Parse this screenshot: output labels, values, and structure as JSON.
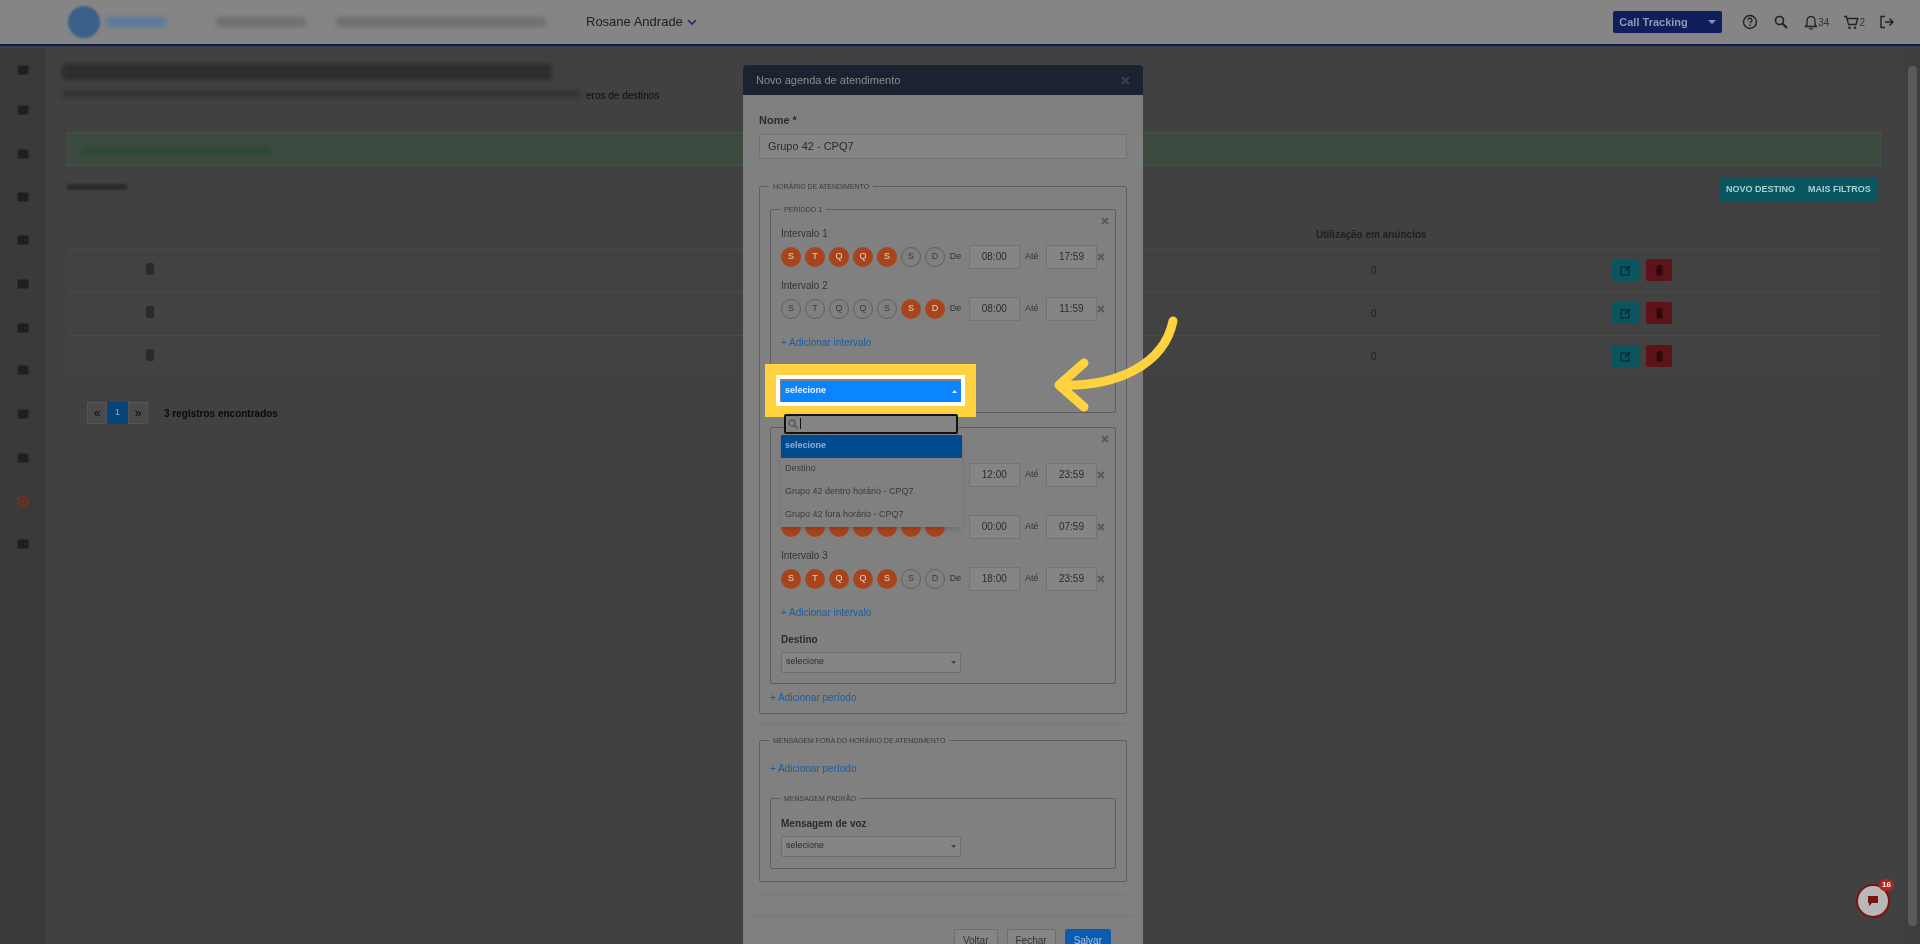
{
  "topbar": {
    "user": "Rosane Andrade",
    "product": "Call Tracking",
    "notifications": "34",
    "cart": "2"
  },
  "page": {
    "subtitle_tail": "eros de destinos",
    "buttons": [
      "NOVO DESTINO",
      "MAIS FILTROS"
    ],
    "column": "Utilização em anúncios",
    "rows": [
      {
        "usage": "0"
      },
      {
        "usage": "0"
      },
      {
        "usage": "0"
      }
    ],
    "pages": [
      {
        "label": "1",
        "selected": true
      }
    ],
    "prev": "«",
    "next": "»",
    "count": "3 registros encontrados"
  },
  "modal": {
    "title": "Novo agenda de atendimento",
    "name_label": "Nome *",
    "name_value": "Grupo 42 - CPQ7",
    "schedule": {
      "legend": "HORÁRIO DE ATENDIMENTO",
      "add_period": "+ Adicionar período",
      "periods": [
        {
          "legend": "PERÍODO 1",
          "add_interval": "+ Adicionar intervalo",
          "destination": {
            "value": "selecione",
            "highlighted": true
          },
          "intervals": [
            {
              "label": "Intervalo 1",
              "days": [
                {
                  "letter": "S",
                  "on": true
                },
                {
                  "letter": "T",
                  "on": true
                },
                {
                  "letter": "Q",
                  "on": true
                },
                {
                  "letter": "Q",
                  "on": true
                },
                {
                  "letter": "S",
                  "on": true
                },
                {
                  "letter": "S",
                  "on": false
                },
                {
                  "letter": "D",
                  "on": false
                }
              ],
              "from_label": "De",
              "from": "08:00",
              "to_label": "Até",
              "to": "17:59"
            },
            {
              "label": "Intervalo 2",
              "days": [
                {
                  "letter": "S",
                  "on": false
                },
                {
                  "letter": "T",
                  "on": false
                },
                {
                  "letter": "Q",
                  "on": false
                },
                {
                  "letter": "Q",
                  "on": false
                },
                {
                  "letter": "S",
                  "on": false
                },
                {
                  "letter": "S",
                  "on": true
                },
                {
                  "letter": "D",
                  "on": true
                }
              ],
              "from_label": "De",
              "from": "08:00",
              "to_label": "Até",
              "to": "11:59"
            }
          ]
        },
        {
          "add_interval": "+ Adicionar intervalo",
          "destination": {
            "label": "Destino",
            "value": "selecione",
            "highlighted": false
          },
          "intervals": [
            {
              "from": "12:00",
              "to_label": "Até",
              "to": "23:59"
            },
            {
              "days": [
                {
                  "on": true
                },
                {
                  "on": true
                },
                {
                  "on": true
                },
                {
                  "on": true
                },
                {
                  "on": true
                },
                {
                  "on": true
                },
                {
                  "on": true
                }
              ],
              "from": "00:00",
              "to_label": "Até",
              "to": "07:59"
            },
            {
              "label": "Intervalo 3",
              "days": [
                {
                  "letter": "S",
                  "on": true
                },
                {
                  "letter": "T",
                  "on": true
                },
                {
                  "letter": "Q",
                  "on": true
                },
                {
                  "letter": "Q",
                  "on": true
                },
                {
                  "letter": "S",
                  "on": true
                },
                {
                  "letter": "S",
                  "on": false
                },
                {
                  "letter": "D",
                  "on": false
                }
              ],
              "from_label": "De",
              "from": "18:00",
              "to_label": "Até",
              "to": "23:59"
            }
          ]
        }
      ]
    },
    "off_hours": {
      "legend": "MENSAGEM FORA DO HORÁRIO DE ATENDIMENTO",
      "add_period": "+ Adicionar período",
      "default": {
        "legend": "MENSAGEM PADRÃO",
        "label": "Mensagem de voz",
        "value": "selecione"
      }
    },
    "buttons": [
      {
        "label": "Voltar",
        "kind": "default"
      },
      {
        "label": "Fechar",
        "kind": "default"
      },
      {
        "label": "Salvar",
        "kind": "primary"
      }
    ]
  },
  "dropdown": {
    "options": [
      {
        "label": "selecione",
        "selected": true
      },
      {
        "label": "Destino",
        "selected": false
      },
      {
        "label": "Grupo 42 dentro horário - CPQ7",
        "selected": false
      },
      {
        "label": "Grupo 42 fora horário - CPQ7",
        "selected": false
      }
    ]
  },
  "chat": {
    "badge": "16"
  }
}
